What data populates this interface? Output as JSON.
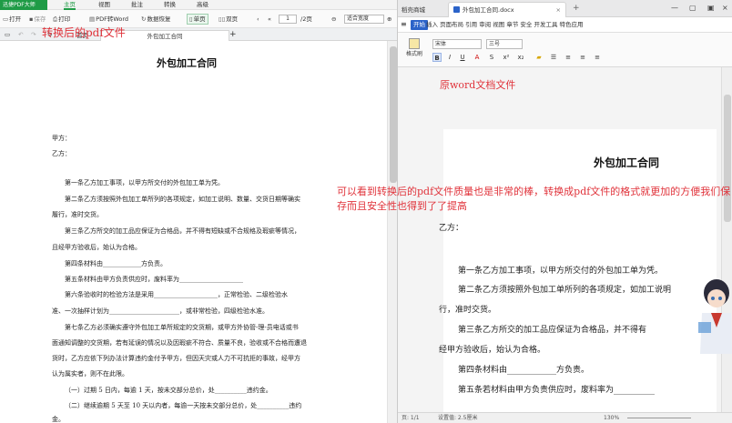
{
  "left": {
    "app_name": "迅捷PDF大师",
    "menus": [
      "主页",
      "视图",
      "批注",
      "转换",
      "高级"
    ],
    "toolbar": {
      "open": "打开",
      "save": "保存",
      "print": "打印",
      "pdf_to_word": "PDF转Word",
      "data_recover": "数据恢复",
      "single_page": "单页",
      "double_page": "双页",
      "page_value": "1",
      "page_total": "/2页",
      "zoom": "适合宽度"
    },
    "tabs": {
      "home": "首页",
      "doc": "外包加工合同"
    },
    "annotation": "转换后的pdf文件",
    "doc": {
      "title": "外包加工合同",
      "lines": [
        "甲方：",
        "乙方：",
        "第一条乙方加工事项，以甲方所交付的外包加工单为凭。",
        "第二条乙方须按照外包加工单所列的各项规定，如加工说明、数量、交货日期等确实",
        "履行，准时交货。",
        "第三条乙方所交的加工品应保证为合格品，并不得有短缺或不合规格及瑕疵等情况，",
        "且经甲方验收后，始认为合格。",
        "第四条材料由____________方负责。",
        "第五条材料由甲方负责供应时，废料率为____________________",
        "第六条验收时的检验方法是采用____________________，正常检验、二级检验水",
        "准、一次抽样计划为______________________，或非常检验，四级检验水准。",
        "第七条乙方必须确实遵守外包加工单所规定的交货期，或甲方外协管-理-员电话或书",
        "面通知调整的交货期，若有延误的情况以及因瑕疵不符合、质量不良，验收或不合格而遭退",
        "货时，乙方应依下列办法计算违约金付予甲方，但因天灾或人力不可抗拒的事故，经甲方",
        "认为属实者，则不在此限。",
        "（一）过期 5 日内，每逾 1 天，按未交部分总价，处__________违约金。",
        "（二）继续逾期 5 天至 10 天以内者，每逾一天按未交部分总价，处__________违约",
        "金。"
      ]
    }
  },
  "right": {
    "tab_home": "稻壳商城",
    "tab_doc": "外包加工合同.docx",
    "start": "开始",
    "menus": "插入 页面布局 引用 审阅 视图 章节 安全 开发工具 特色应用",
    "format_painter": "格式刷",
    "font": "宋体",
    "size": "三号",
    "annotation": "原word文档文件",
    "doc": {
      "title": "外包加工合同",
      "party_b": "乙方：",
      "lines": [
        "第一条乙方加工事项，以甲方所交付的外包加工单为凭。",
        "第二条乙方须按照外包加工单所列的各项规定，如加工说明",
        "行，准时交货。",
        "第三条乙方所交的加工品应保证为合格品，并不得有",
        "经甲方验收后，始认为合格。",
        "第四条材料由____________方负责。",
        "第五条若材料由甲方负责供应时，废料率为__________"
      ]
    },
    "status": {
      "page": "页: 1/1",
      "settings": "设置值: 2.5厘米",
      "zoom": "130%"
    }
  },
  "overlay_annotation": "可以看到转换后的pdf文件质量也是非常的棒，转换成pdf文件的格式就更加的方便我们保存而且安全性也得到了了提高"
}
